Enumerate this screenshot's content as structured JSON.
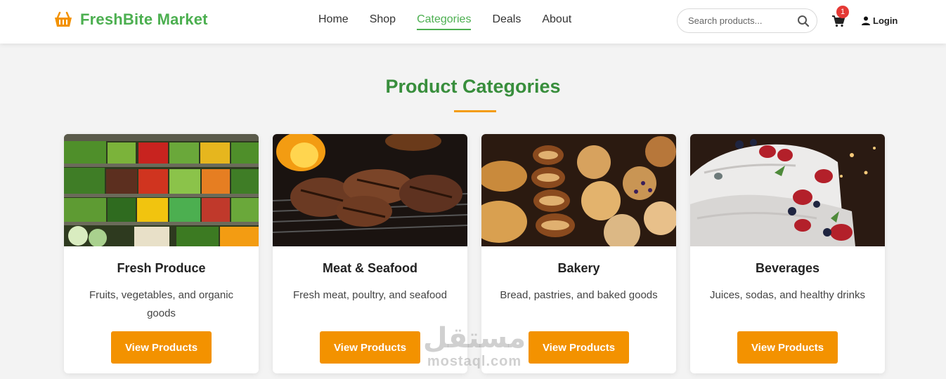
{
  "header": {
    "brand_name": "FreshBite Market",
    "nav": [
      "Home",
      "Shop",
      "Categories",
      "Deals",
      "About"
    ],
    "active_nav": "Categories",
    "search_placeholder": "Search products...",
    "cart_count": "1",
    "login_label": "Login"
  },
  "section": {
    "title": "Product Categories"
  },
  "categories": [
    {
      "title": "Fresh Produce",
      "description": "Fruits, vegetables, and organic goods",
      "button": "View Products",
      "image": "vegetable-shelves"
    },
    {
      "title": "Meat & Seafood",
      "description": "Fresh meat, poultry, and seafood",
      "button": "View Products",
      "image": "grilled-meat"
    },
    {
      "title": "Bakery",
      "description": "Bread, pastries, and baked goods",
      "button": "View Products",
      "image": "pastries"
    },
    {
      "title": "Beverages",
      "description": "Juices, sodas, and healthy drinks",
      "button": "View Products",
      "image": "berry-cake"
    }
  ],
  "watermark": {
    "arabic": "مستقل",
    "latin": "mostaql.com"
  },
  "colors": {
    "brand_green": "#4caf50",
    "title_green": "#388e3c",
    "accent_orange": "#f39200",
    "badge_red": "#e53935"
  }
}
